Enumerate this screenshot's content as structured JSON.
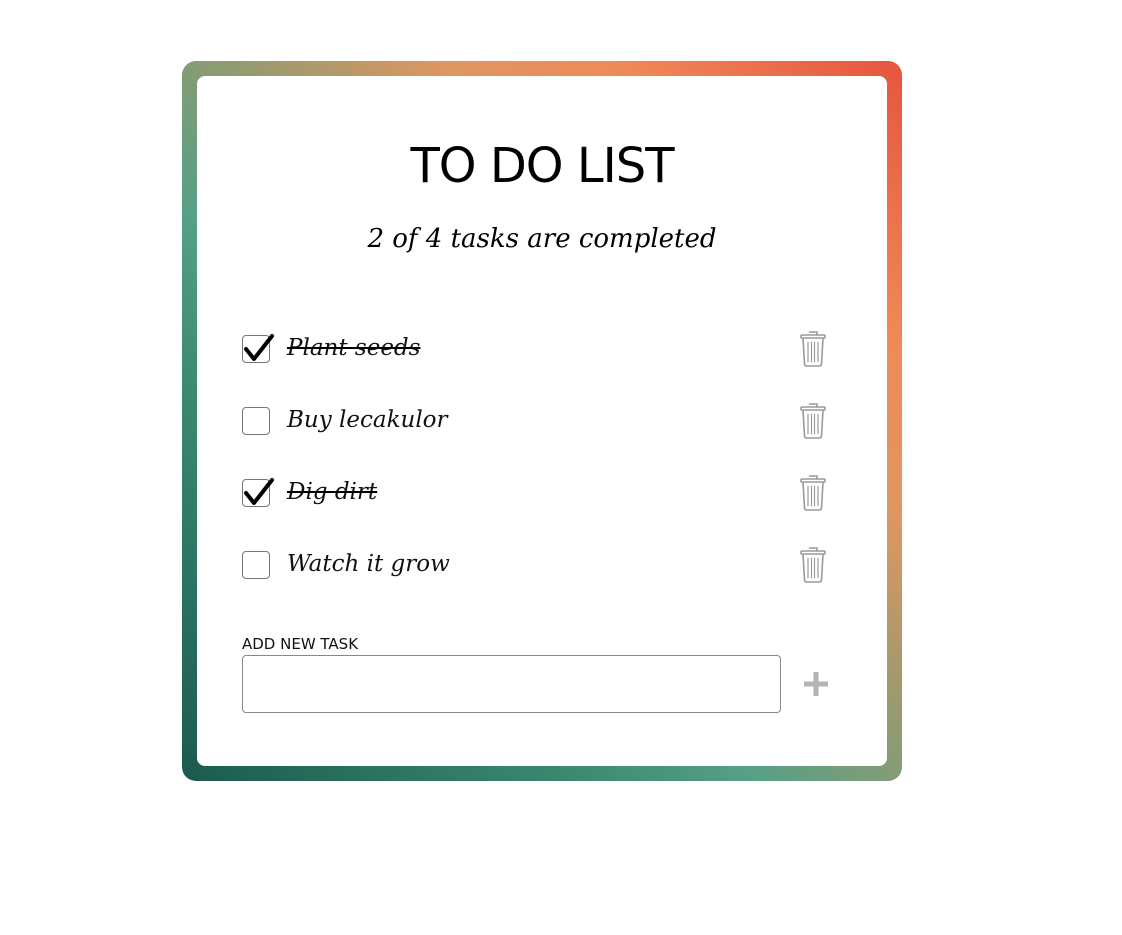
{
  "app": {
    "title": "TO DO LIST",
    "summary": "2 of 4 tasks are completed",
    "completed_count": 2,
    "total_count": 4
  },
  "tasks": [
    {
      "label": "Plant seeds",
      "completed": true,
      "delete_icon": "trash-icon"
    },
    {
      "label": "Buy lecakulor",
      "completed": false,
      "delete_icon": "trash-icon"
    },
    {
      "label": "Dig dirt",
      "completed": true,
      "delete_icon": "trash-icon"
    },
    {
      "label": "Watch it grow",
      "completed": false,
      "delete_icon": "trash-icon"
    }
  ],
  "add_task": {
    "label": "ADD NEW TASK",
    "value": "",
    "placeholder": "",
    "button_icon": "plus-icon"
  },
  "colors": {
    "frame_gradient": [
      "#1b5a4e",
      "#56a086",
      "#df9661",
      "#e6543f"
    ],
    "icon_gray": "#9a9a9a",
    "plus_gray": "#b5b5b5"
  }
}
